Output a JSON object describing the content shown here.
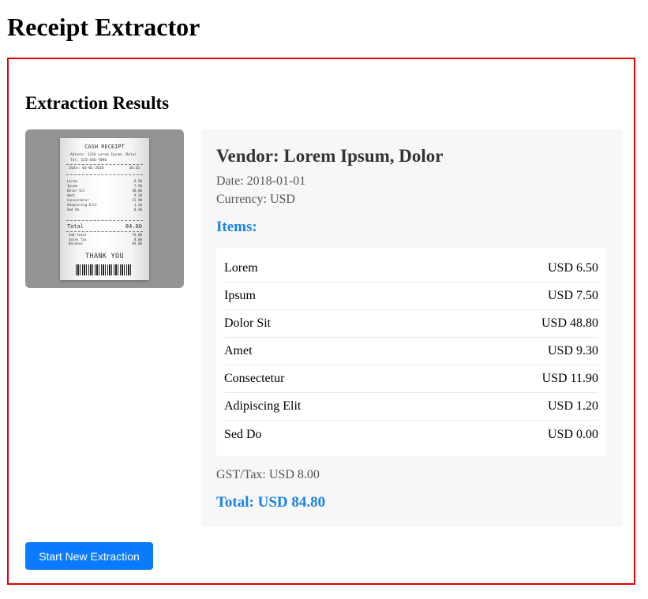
{
  "app": {
    "title": "Receipt Extractor"
  },
  "results": {
    "heading": "Extraction Results",
    "receipt_image": {
      "title": "CASH RECEIPT",
      "address": "Adress: 1234 Lorem Ipsum, Dolor\nTel: 123-456-7890",
      "date_label": "Date: 01-01-2018",
      "time": "10:35",
      "lines": [
        {
          "name": "Lorem",
          "amount": "6.50"
        },
        {
          "name": "Ipsum",
          "amount": "7.50"
        },
        {
          "name": "Dolor Sit",
          "amount": "48.00"
        },
        {
          "name": "Amet",
          "amount": "9.30"
        },
        {
          "name": "Consectetur",
          "amount": "11.90"
        },
        {
          "name": "Adipiscing Elit",
          "amount": "1.20"
        },
        {
          "name": "Sed Do",
          "amount": "0.40"
        }
      ],
      "total_label": "Total",
      "total_value": "84.80",
      "summary": [
        {
          "name": "Sub-total",
          "amount": "76.80"
        },
        {
          "name": "Sales Tax",
          "amount": "8.00"
        },
        {
          "name": "Balance",
          "amount": "84.80"
        }
      ],
      "thanks": "THANK YOU"
    },
    "vendor": "Vendor: Lorem Ipsum, Dolor",
    "date": "Date: 2018-01-01",
    "currency": "Currency: USD",
    "items_heading": "Items:",
    "items": [
      {
        "name": "Lorem",
        "price": "USD 6.50"
      },
      {
        "name": "Ipsum",
        "price": "USD 7.50"
      },
      {
        "name": "Dolor Sit",
        "price": "USD 48.80"
      },
      {
        "name": "Amet",
        "price": "USD 9.30"
      },
      {
        "name": "Consectetur",
        "price": "USD 11.90"
      },
      {
        "name": "Adipiscing Elit",
        "price": "USD 1.20"
      },
      {
        "name": "Sed Do",
        "price": "USD 0.00"
      }
    ],
    "tax": "GST/Tax: USD 8.00",
    "total": "Total: USD 84.80"
  },
  "actions": {
    "new_extraction_label": "Start New Extraction"
  },
  "colors": {
    "accent": "#0a7bff",
    "highlight": "#1a82e2",
    "border": "#e60000"
  }
}
